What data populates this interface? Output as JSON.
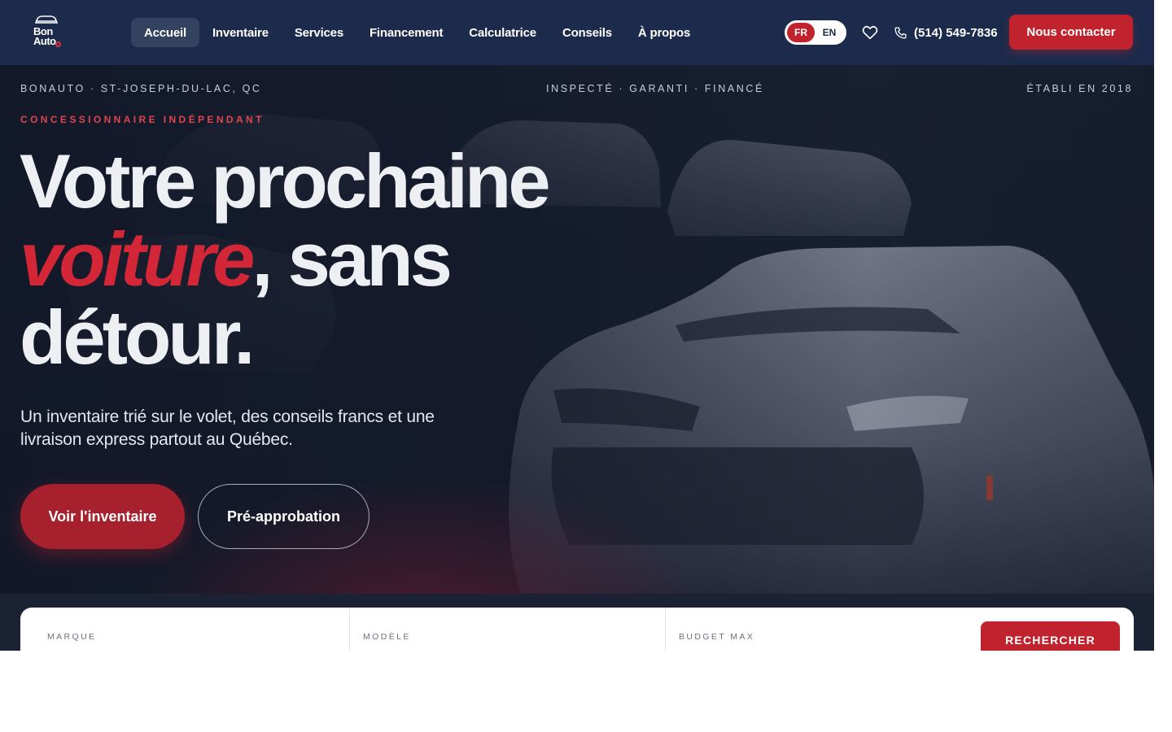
{
  "brand": {
    "logo_line1": "Bon",
    "logo_line2": "Auto"
  },
  "nav": {
    "items": [
      {
        "label": "Accueil",
        "active": true
      },
      {
        "label": "Inventaire"
      },
      {
        "label": "Services"
      },
      {
        "label": "Financement"
      },
      {
        "label": "Calculatrice"
      },
      {
        "label": "Conseils"
      },
      {
        "label": "À propos"
      }
    ],
    "lang_fr": "FR",
    "lang_en": "EN",
    "phone": "(514) 549-7836",
    "contact_label": "Nous contacter"
  },
  "hero": {
    "meta_left": "BONAUTO · ST-JOSEPH-DU-LAC, QC",
    "meta_center": "INSPECTÉ · GARANTI · FINANCÉ",
    "meta_right": "ÉTABLI EN 2018",
    "eyebrow": "CONCESSIONNAIRE INDÉPENDANT",
    "headline_line1": "Votre prochaine",
    "headline_accent": "voiture",
    "headline_line2_rest": ", sans",
    "headline_line3": "détour.",
    "subtitle": "Un inventaire trié sur le volet, des conseils francs et une livraison express partout au Québec.",
    "primary_cta": "Voir l'inventaire",
    "secondary_cta": "Pré-approbation"
  },
  "search": {
    "make_label": "MARQUE",
    "model_label": "MODÈLE",
    "budget_label": "BUDGET MAX",
    "submit_label": "RECHERCHER"
  },
  "colors": {
    "nav_bg": "#1c2b4b",
    "accent_red": "#c0232d",
    "hero_bg": "#161d2c"
  }
}
